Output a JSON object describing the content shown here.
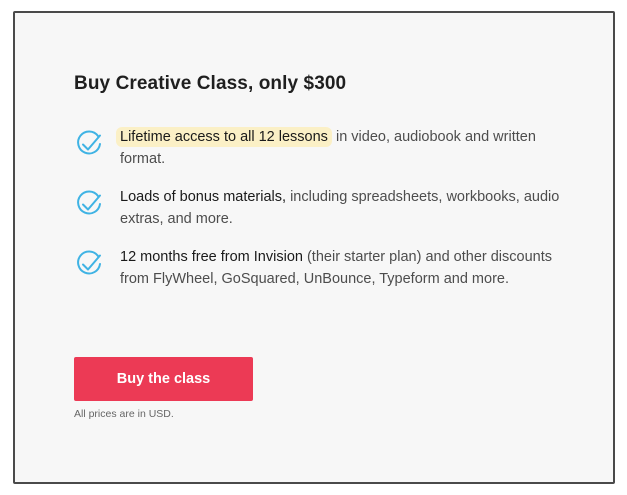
{
  "title": "Buy Creative Class, only $300",
  "accent_color": "#ec3a55",
  "check_color": "#3fb3e4",
  "features": [
    {
      "icon": "checkmark-icon",
      "highlight": "Lifetime access to all 12 lessons",
      "rest": " in video, audiobook and written format."
    },
    {
      "icon": "checkmark-icon",
      "strong": "Loads of bonus materials,",
      "rest": " including spreadsheets, workbooks, audio extras, and more."
    },
    {
      "icon": "checkmark-icon",
      "strong": "12 months free from Invision",
      "rest": " (their starter plan) and other discounts from FlyWheel, GoSquared, UnBounce, Typeform and more."
    }
  ],
  "cta": {
    "label": "Buy the class"
  },
  "note": "All prices are in USD."
}
